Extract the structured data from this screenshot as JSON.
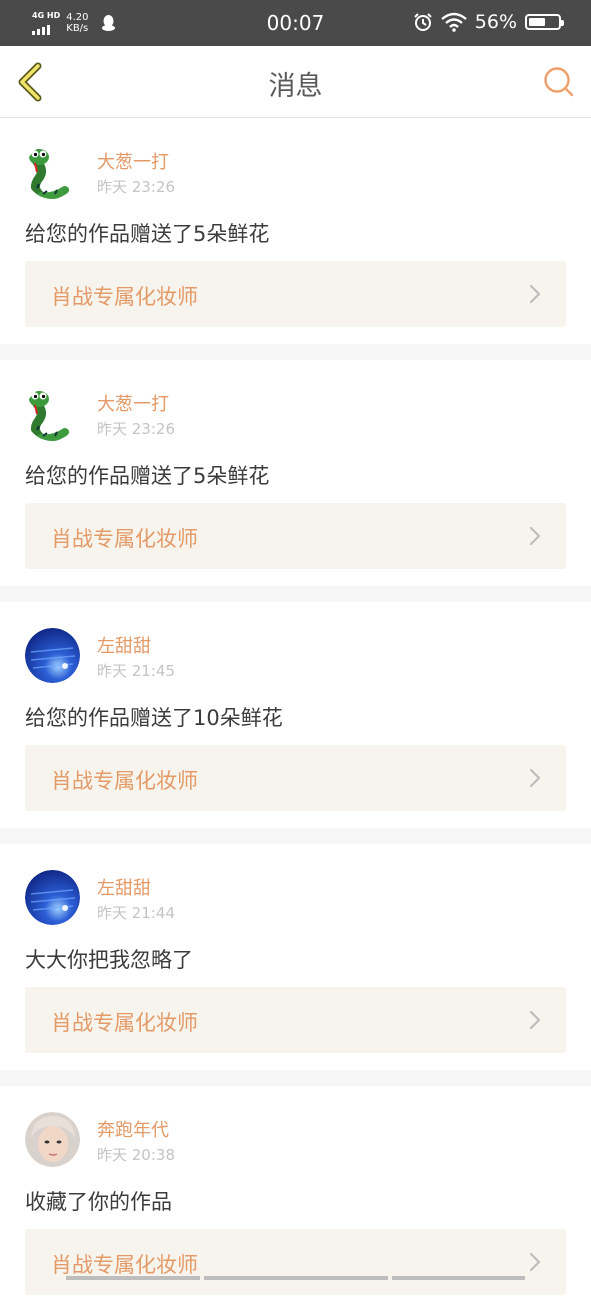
{
  "status_bar": {
    "network": "4G HD",
    "speed": "4.20\nKB/s",
    "time": "00:07",
    "battery": "56%",
    "battery_level": 0.56
  },
  "nav": {
    "title": "消息"
  },
  "messages": [
    {
      "name": "大葱一打",
      "time": "昨天 23:26",
      "text": "给您的作品赠送了5朵鲜花",
      "link": "肖战专属化妆师",
      "avatar": "snake"
    },
    {
      "name": "大葱一打",
      "time": "昨天 23:26",
      "text": "给您的作品赠送了5朵鲜花",
      "link": "肖战专属化妆师",
      "avatar": "snake"
    },
    {
      "name": "左甜甜",
      "time": "昨天 21:45",
      "text": "给您的作品赠送了10朵鲜花",
      "link": "肖战专属化妆师",
      "avatar": "blue"
    },
    {
      "name": "左甜甜",
      "time": "昨天 21:44",
      "text": "大大你把我忽略了",
      "link": "肖战专属化妆师",
      "avatar": "blue"
    },
    {
      "name": "奔跑年代",
      "time": "昨天 20:38",
      "text": "收藏了你的作品",
      "link": "肖战专属化妆师",
      "avatar": "person"
    }
  ],
  "colors": {
    "accent": "#e49a67",
    "status_bar_bg": "#4a4a4a",
    "link_box_bg": "#f6f4ed"
  },
  "icons": [
    "signal-icon",
    "qq-icon",
    "alarm-icon",
    "wifi-icon",
    "battery-icon",
    "back-icon",
    "search-icon",
    "chevron-right-icon"
  ]
}
